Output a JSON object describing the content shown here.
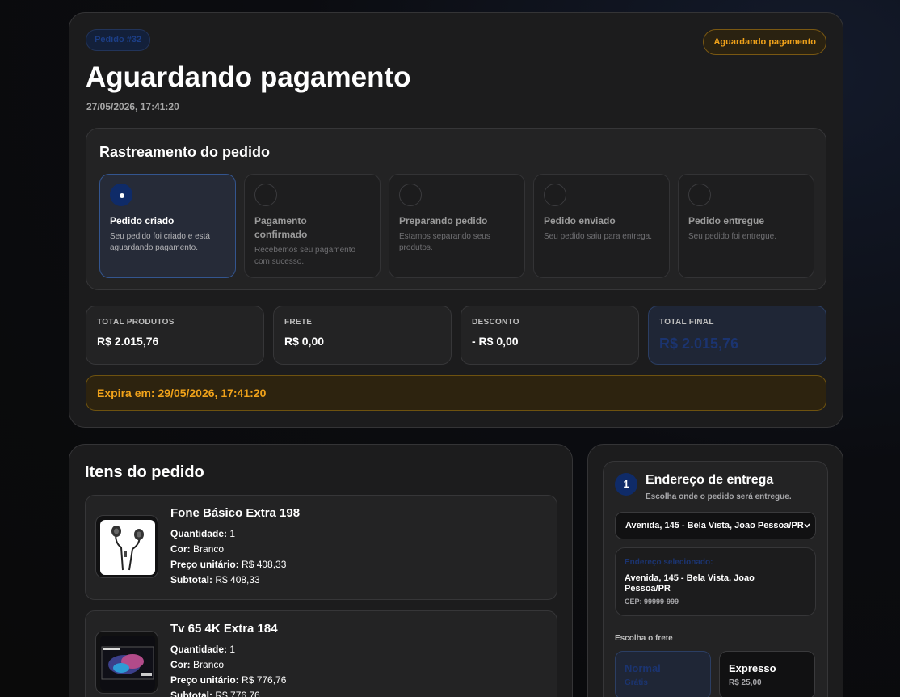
{
  "header": {
    "order_tag": "Pedido #32",
    "status_badge": "Aguardando pagamento",
    "title": "Aguardando pagamento",
    "date": "27/05/2026, 17:41:20"
  },
  "tracking": {
    "title": "Rastreamento do pedido",
    "steps": [
      {
        "title": "Pedido criado",
        "desc": "Seu pedido foi criado e está aguardando pagamento.",
        "active": true
      },
      {
        "title": "Pagamento confirmado",
        "desc": "Recebemos seu pagamento com sucesso.",
        "active": false
      },
      {
        "title": "Preparando pedido",
        "desc": "Estamos separando seus produtos.",
        "active": false
      },
      {
        "title": "Pedido enviado",
        "desc": "Seu pedido saiu para entrega.",
        "active": false
      },
      {
        "title": "Pedido entregue",
        "desc": "Seu pedido foi entregue.",
        "active": false
      }
    ]
  },
  "totals": [
    {
      "label": "TOTAL PRODUTOS",
      "value": "R$ 2.015,76"
    },
    {
      "label": "FRETE",
      "value": "R$ 0,00"
    },
    {
      "label": "DESCONTO",
      "value": "- R$ 0,00"
    },
    {
      "label": "TOTAL FINAL",
      "value": "R$ 2.015,76"
    }
  ],
  "expire": "Expira em: 29/05/2026, 17:41:20",
  "items": {
    "title": "Itens do pedido",
    "list": [
      {
        "name": "Fone Básico Extra 198",
        "qty_label": "Quantidade:",
        "qty": "1",
        "color_label": "Cor:",
        "color": "Branco",
        "unit_label": "Preço unitário:",
        "unit": "R$ 408,33",
        "sub_label": "Subtotal:",
        "sub": "R$ 408,33",
        "icon": "earphones-image"
      },
      {
        "name": "Tv 65 4K Extra 184",
        "qty_label": "Quantidade:",
        "qty": "1",
        "color_label": "Cor:",
        "color": "Branco",
        "unit_label": "Preço unitário:",
        "unit": "R$ 776,76",
        "sub_label": "Subtotal:",
        "sub": "R$ 776,76",
        "icon": "tv-image"
      }
    ]
  },
  "delivery": {
    "step": "1",
    "title": "Endereço de entrega",
    "subtitle": "Escolha onde o pedido será entregue.",
    "select_value": "Avenida, 145 - Bela Vista, Joao Pessoa/PR",
    "selected_label": "Endereço selecionado:",
    "selected_address": "Avenida, 145 - Bela Vista, Joao Pessoa/PR",
    "cep": "CEP: 99999-999",
    "frete_title": "Escolha o frete",
    "frete_options": [
      {
        "name": "Normal",
        "price": "Grátis",
        "selected": true
      },
      {
        "name": "Expresso",
        "price": "R$ 25,00",
        "selected": false
      }
    ]
  },
  "colors": {
    "accent_blue": "#0f2b68",
    "warning": "#f0a21a",
    "card_bg": "#1c1c1d"
  }
}
